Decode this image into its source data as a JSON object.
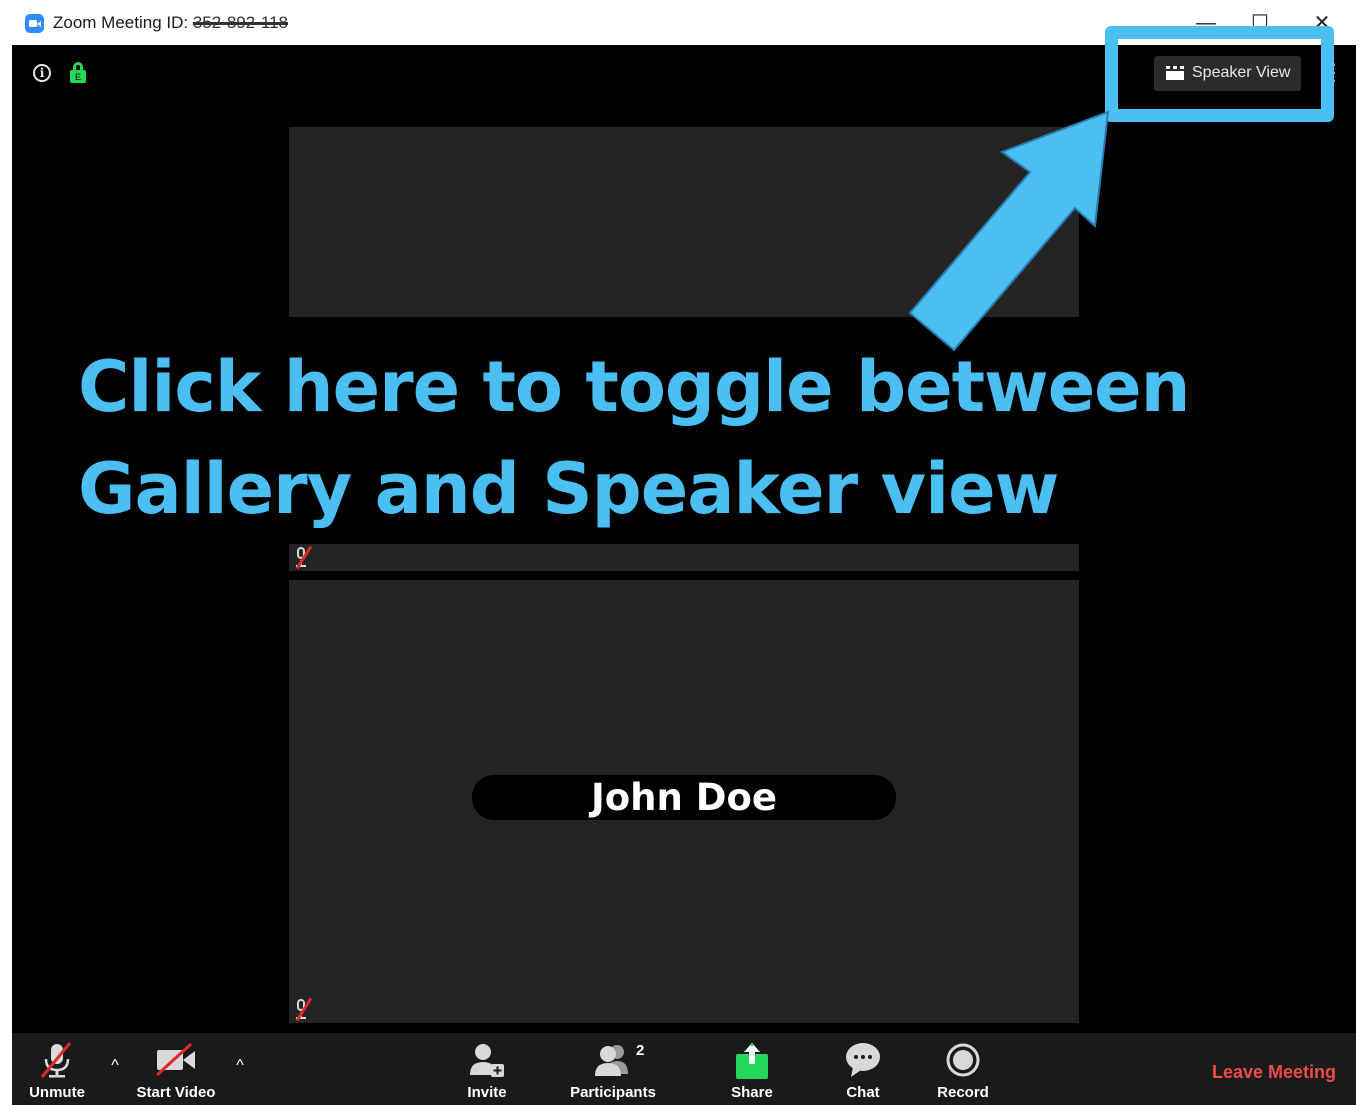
{
  "titlebar": {
    "title_prefix": "Zoom Meeting ID: ",
    "meeting_id": "352-892-118",
    "minimize": "—",
    "maximize": "☐",
    "close": "✕"
  },
  "top_controls": {
    "lock_letter": "E",
    "speaker_view_label": "Speaker View"
  },
  "participants": {
    "main_tile_name": "John Doe"
  },
  "annotation": {
    "text": "Click here to toggle between\nGallery and Speaker view",
    "color": "#4bbff2"
  },
  "toolbar": {
    "unmute": "Unmute",
    "start_video": "Start Video",
    "invite": "Invite",
    "participants": "Participants",
    "participants_count": "2",
    "share": "Share",
    "chat": "Chat",
    "record": "Record",
    "leave": "Leave Meeting",
    "caret": "^"
  },
  "colors": {
    "window_bg": "#000000",
    "tile_bg": "#242424",
    "toolbar_bg": "#1a1a1a",
    "share_green": "#23d959",
    "leave_red": "#f04b4b",
    "accent_blue": "#2d8cff"
  }
}
